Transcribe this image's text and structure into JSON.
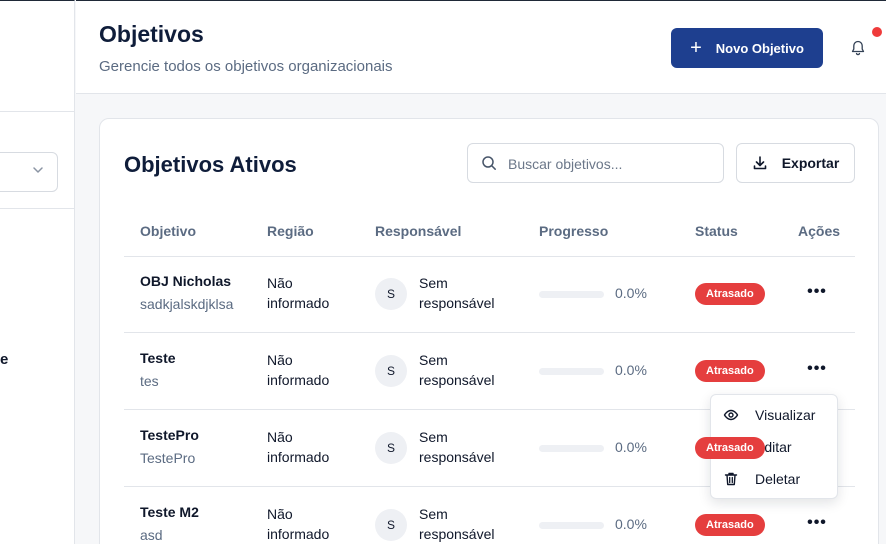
{
  "sidebar": {
    "partial_text": "e"
  },
  "header": {
    "title": "Objetivos",
    "subtitle": "Gerencie todos os objetivos organizacionais",
    "new_button_label": "Novo Objetivo",
    "new_button_icon": "plus-icon",
    "notification_icon": "bell-icon",
    "notification_dot_color": "#ef3b3b"
  },
  "card": {
    "title": "Objetivos Ativos",
    "search_placeholder": "Buscar objetivos...",
    "search_value": "",
    "export_label": "Exportar",
    "columns": [
      "Objetivo",
      "Região",
      "Responsável",
      "Progresso",
      "Status",
      "Ações"
    ],
    "rows": [
      {
        "name": "OBJ Nicholas",
        "description": "sadkjalskdjklsa",
        "region": "Não informado",
        "avatar_initial": "S",
        "owner": "Sem responsável",
        "progress": 0,
        "progress_label": "0.0%",
        "status": "Atrasado"
      },
      {
        "name": "Teste",
        "description": "tes",
        "region": "Não informado",
        "avatar_initial": "S",
        "owner": "Sem responsável",
        "progress": 0,
        "progress_label": "0.0%",
        "status": "Atrasado"
      },
      {
        "name": "TestePro",
        "description": "TestePro",
        "region": "Não informado",
        "avatar_initial": "S",
        "owner": "Sem responsável",
        "progress": 0,
        "progress_label": "0.0%",
        "status": "Atrasado"
      },
      {
        "name": "Teste M2",
        "description": "asd",
        "region": "Não informado",
        "avatar_initial": "S",
        "owner": "Sem responsável",
        "progress": 0,
        "progress_label": "0.0%",
        "status": "Atrasado"
      }
    ],
    "actions_icon": "more-horizontal-icon"
  },
  "context_menu": {
    "items": [
      {
        "label": "Visualizar",
        "icon": "eye-icon"
      },
      {
        "label": "Editar",
        "icon": "edit-icon"
      },
      {
        "label": "Deletar",
        "icon": "trash-icon"
      }
    ]
  },
  "colors": {
    "primary": "#1e3f8f",
    "danger": "#e53e3e",
    "muted_text": "#5b6b82",
    "heading": "#0f1d3a"
  }
}
